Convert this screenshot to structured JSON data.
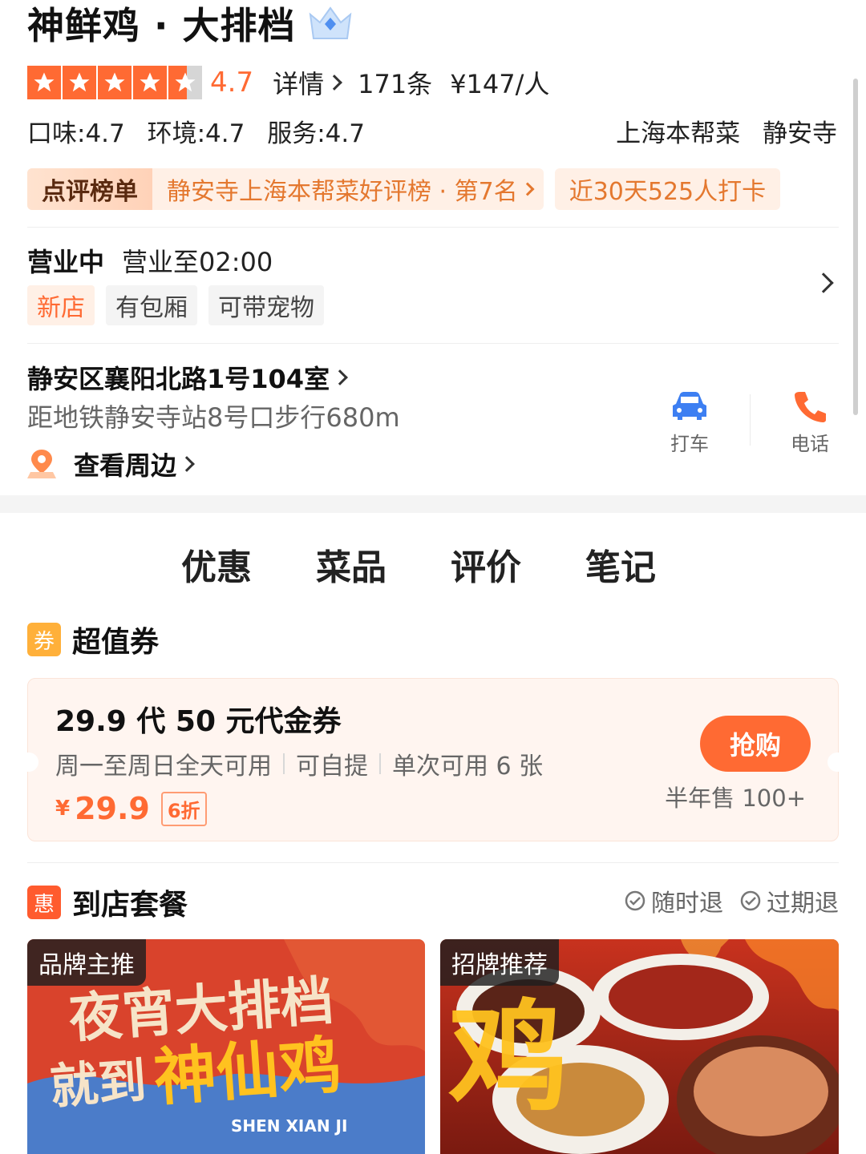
{
  "shop": {
    "name": "神鲜鸡 · 大排档",
    "rating": "4.7",
    "detail_label": "详情",
    "review_count": "171条",
    "price_per_person": "¥147/人",
    "rating_fraction": 0.94,
    "sub_scores": [
      "口味:4.7",
      "环境:4.7",
      "服务:4.7"
    ],
    "cuisine": "上海本帮菜",
    "area": "静安寺"
  },
  "ranking": {
    "badge": "点评榜单",
    "text": "静安寺上海本帮菜好评榜 · 第7名",
    "checkin": "近30天525人打卡"
  },
  "hours": {
    "status": "营业中",
    "text": "营业至02:00",
    "tags": [
      "新店",
      "有包厢",
      "可带宠物"
    ]
  },
  "location": {
    "address": "静安区襄阳北路1号104室",
    "metro": "距地铁静安寺站8号口步行680m",
    "nearby": "查看周边",
    "taxi_label": "打车",
    "phone_label": "电话"
  },
  "tabs": [
    "优惠",
    "菜品",
    "评价",
    "笔记"
  ],
  "coupon_section": {
    "icon_text": "券",
    "title": "超值券",
    "coupon": {
      "title": "29.9 代 50 元代金券",
      "desc": [
        "周一至周日全天可用",
        "可自提",
        "单次可用 6 张"
      ],
      "currency": "¥",
      "price": "29.9",
      "discount": "6折",
      "buy_label": "抢购",
      "sold": "半年售 100+"
    }
  },
  "package_section": {
    "icon_text": "惠",
    "title": "到店套餐",
    "guarantees": [
      "随时退",
      "过期退"
    ],
    "cards": [
      {
        "tag": "品牌主推",
        "line1": "夜宵大排档",
        "line2a": "就到",
        "line2b": "神仙鸡",
        "sub": "SHEN XIAN JI"
      },
      {
        "tag": "招牌推荐",
        "overlay": "鸡"
      }
    ]
  },
  "colors": {
    "accent": "#ff6a33",
    "rank_text": "#e4782f",
    "tab_underline": "#ff5b2e",
    "coupon_bg": "#fff5f0"
  }
}
